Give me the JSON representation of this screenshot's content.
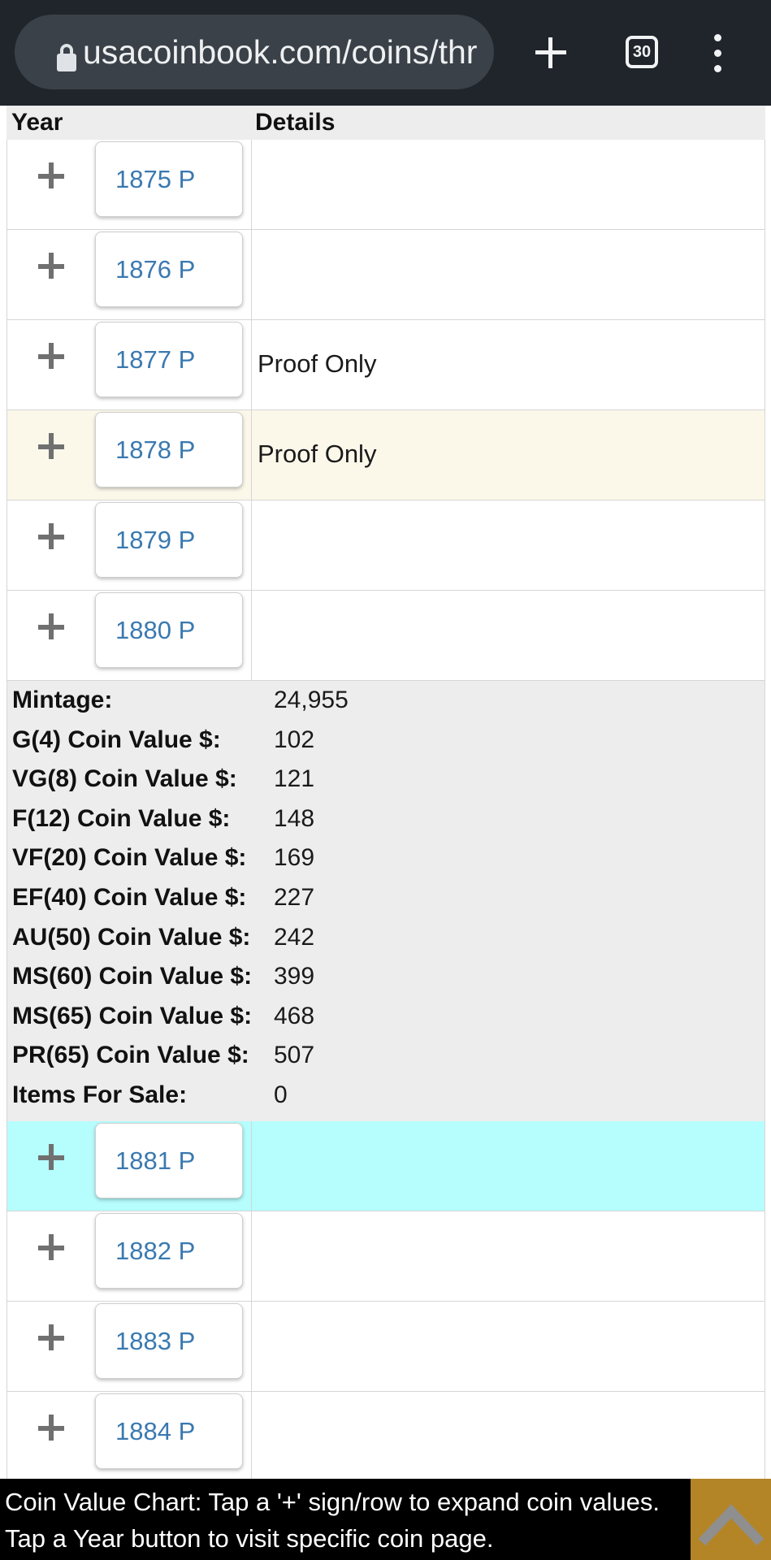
{
  "browser": {
    "url": "usacoinbook.com/coins/thr",
    "tab_count": "30"
  },
  "table": {
    "headers": {
      "year": "Year",
      "details": "Details"
    },
    "rows_before": [
      {
        "year": "1875 P",
        "details": ""
      },
      {
        "year": "1876 P",
        "details": ""
      },
      {
        "year": "1877 P",
        "details": "Proof Only"
      },
      {
        "year": "1878 P",
        "details": "Proof Only"
      },
      {
        "year": "1879 P",
        "details": ""
      },
      {
        "year": "1880 P",
        "details": ""
      }
    ],
    "expanded_details": [
      {
        "label": "Mintage:",
        "value": "24,955"
      },
      {
        "label": "G(4) Coin Value $:",
        "value": "102"
      },
      {
        "label": "VG(8) Coin Value $:",
        "value": "121"
      },
      {
        "label": "F(12) Coin Value $:",
        "value": "148"
      },
      {
        "label": "VF(20) Coin Value $:",
        "value": "169"
      },
      {
        "label": "EF(40) Coin Value $:",
        "value": "227"
      },
      {
        "label": "AU(50) Coin Value $:",
        "value": "242"
      },
      {
        "label": "MS(60) Coin Value $:",
        "value": "399"
      },
      {
        "label": "MS(65) Coin Value $:",
        "value": "468"
      },
      {
        "label": "PR(65) Coin Value $:",
        "value": "507"
      },
      {
        "label": "Items For Sale:",
        "value": "0"
      }
    ],
    "rows_after": [
      {
        "year": "1881 P",
        "details": ""
      },
      {
        "year": "1882 P",
        "details": ""
      },
      {
        "year": "1883 P",
        "details": ""
      },
      {
        "year": "1884 P",
        "details": ""
      }
    ]
  },
  "footer": {
    "line1": "Coin Value Chart: Tap a '+' sign/row to expand coin values.",
    "line2": "Tap a Year button to visit specific coin page."
  },
  "colors": {
    "link": "#3a79b0",
    "highlight_cream": "#fbf8ea",
    "highlight_cyan": "#b6fdfd",
    "back_to_top": "#b38527"
  }
}
